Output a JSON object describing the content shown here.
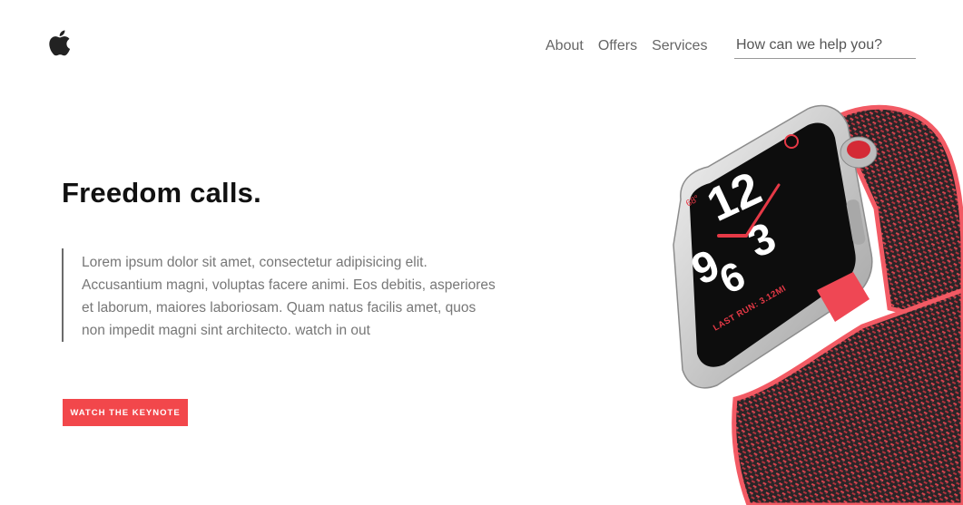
{
  "header": {
    "logo_icon": "apple-logo-icon",
    "nav": [
      {
        "label": "About"
      },
      {
        "label": "Offers"
      },
      {
        "label": "Services"
      }
    ],
    "search": {
      "placeholder": "How can we help you?",
      "value": ""
    }
  },
  "hero": {
    "headline": "Freedom calls.",
    "body": "Lorem ipsum dolor sit amet, consectetur adipisicing elit. Accusantium magni, voluptas facere animi. Eos debitis, asperiores et laborum, maiores laboriosam. Quam natus facilis amet, quos non impedit magni sint architecto. watch in out",
    "cta_label": "WATCH THE KEYNOTE"
  },
  "product": {
    "image_icon": "apple-watch-image",
    "watch_face": {
      "hours": "12",
      "nine": "9",
      "six": "6",
      "three": "3",
      "temperature": "68°",
      "last_run": "LAST RUN: 3.12MI"
    }
  },
  "colors": {
    "accent": "#f2474b",
    "text_muted": "#777777",
    "nav_text": "#666666"
  }
}
